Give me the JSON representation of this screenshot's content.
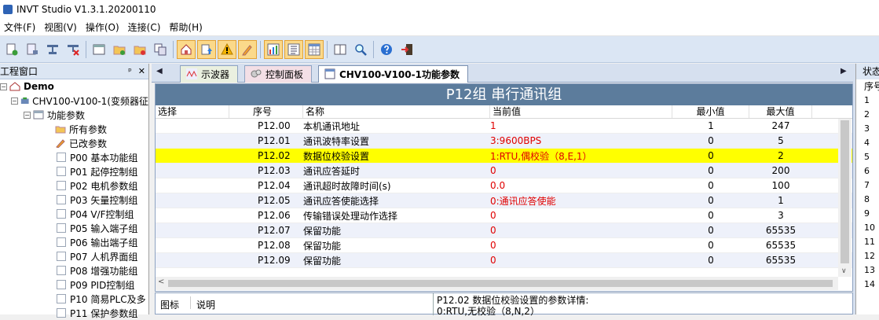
{
  "window": {
    "title": "INVT Studio V1.3.1.20200110"
  },
  "menu": [
    "文件(F)",
    "视图(V)",
    "操作(O)",
    "连接(C)",
    "帮助(H)"
  ],
  "left_panel": {
    "title": "工程窗口",
    "pin": "ᵖ",
    "close": "✕",
    "tree": {
      "root": "Demo",
      "device": "CHV100-V100-1(变频器征",
      "folder": "功能参数",
      "special": [
        "所有参数",
        "已改参数"
      ],
      "groups": [
        "P00 基本功能组",
        "P01 起停控制组",
        "P02 电机参数组",
        "P03 矢量控制组",
        "P04 V/F控制组",
        "P05 输入端子组",
        "P06 输出端子组",
        "P07 人机界面组",
        "P08 增强功能组",
        "P09 PID控制组",
        "P10 简易PLC及多",
        "P11 保护参数组"
      ]
    }
  },
  "tabs": [
    {
      "label": "示波器",
      "active": false
    },
    {
      "label": "控制面板",
      "active": false
    },
    {
      "label": "CHV100-V100-1功能参数",
      "active": true
    }
  ],
  "group_header": "P12组 串行通讯组",
  "table": {
    "headers": {
      "select": "选择",
      "index": "序号",
      "name": "名称",
      "value": "当前值",
      "min": "最小值",
      "max": "最大值"
    },
    "rows": [
      {
        "index": "P12.00",
        "name": "本机通讯地址",
        "value": "1",
        "min": "1",
        "max": "247"
      },
      {
        "index": "P12.01",
        "name": "通讯波特率设置",
        "value": "3:9600BPS",
        "min": "0",
        "max": "5"
      },
      {
        "index": "P12.02",
        "name": "数据位校验设置",
        "value": "1:RTU,偶校验（8,E,1）",
        "min": "0",
        "max": "2"
      },
      {
        "index": "P12.03",
        "name": "通讯应答延时",
        "value": "0",
        "min": "0",
        "max": "200"
      },
      {
        "index": "P12.04",
        "name": "通讯超时故障时间(s)",
        "value": "0.0",
        "min": "0",
        "max": "100"
      },
      {
        "index": "P12.05",
        "name": "通讯应答使能选择",
        "value": "0:通讯应答使能",
        "min": "0",
        "max": "1"
      },
      {
        "index": "P12.06",
        "name": "传输错误处理动作选择",
        "value": "0",
        "min": "0",
        "max": "3"
      },
      {
        "index": "P12.07",
        "name": "保留功能",
        "value": "0",
        "min": "0",
        "max": "65535"
      },
      {
        "index": "P12.08",
        "name": "保留功能",
        "value": "0",
        "min": "0",
        "max": "65535"
      },
      {
        "index": "P12.09",
        "name": "保留功能",
        "value": "0",
        "min": "0",
        "max": "65535"
      }
    ],
    "selected_row_index": 2
  },
  "bottom": {
    "icon_header": "图标",
    "desc_header": "说明",
    "detail_line1": "P12.02 数据位校验设置的参数详情:",
    "detail_line2": "0:RTU,无校验（8,N,2）"
  },
  "right_panel": {
    "title": "状态",
    "sub": "序号",
    "numbers": [
      "1",
      "2",
      "3",
      "4",
      "5",
      "6",
      "7",
      "8",
      "9",
      "10",
      "11",
      "12",
      "13",
      "14"
    ]
  },
  "colors": {
    "selected_row": "#ffff00",
    "value_text": "#e00000",
    "group_header_bg": "#5c7c9c",
    "toolbar_bg": "#dbe6f4"
  }
}
